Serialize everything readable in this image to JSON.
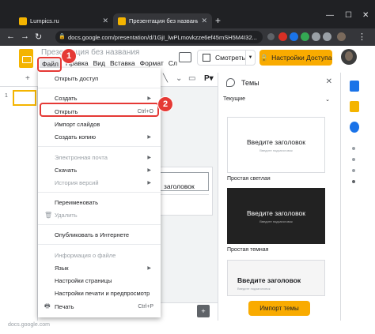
{
  "browser": {
    "tabs": [
      {
        "title": "Lumpics.ru",
        "favicon_color": "#f4b400"
      },
      {
        "title": "Презентация без названия - G",
        "favicon_color": "#f4b400"
      }
    ],
    "address": "docs.google.com/presentation/d/1GjI_lwPLmovkzze6ef45mSH5M4I32..."
  },
  "docs": {
    "title": "Презентация без названия",
    "menubar": [
      "Файл",
      "Правка",
      "Вид",
      "Вставка",
      "Формат",
      "Сл"
    ],
    "present_label": "Смотреть",
    "share_label": "Настройки Доступа",
    "slide_number": "1",
    "slide_title": "заголовок",
    "accent": "#f9ab00"
  },
  "file_menu": {
    "items": [
      {
        "label": "Открыть доступ"
      },
      {
        "label": "Создать",
        "submenu": true
      },
      {
        "label": "Открыть",
        "shortcut": "Ctrl+O"
      },
      {
        "label": "Импорт слайдов"
      },
      {
        "label": "Создать копию",
        "submenu": true
      },
      {
        "label": "Электронная почта",
        "submenu": true,
        "disabled": true
      },
      {
        "label": "Скачать",
        "submenu": true
      },
      {
        "label": "История версий",
        "submenu": true,
        "disabled": true
      },
      {
        "label": "Переименовать"
      },
      {
        "label": "Удалить",
        "disabled": true
      },
      {
        "label": "Опубликовать в Интернете"
      },
      {
        "label": "Информация о файле",
        "disabled": true
      },
      {
        "label": "Язык",
        "submenu": true
      },
      {
        "label": "Настройки страницы"
      },
      {
        "label": "Настройки печати и предпросмотр"
      },
      {
        "label": "Печать",
        "shortcut": "Ctrl+P"
      }
    ]
  },
  "themes": {
    "header": "Темы",
    "selector": "Текущие",
    "cards": [
      {
        "title": "Введите заголовок",
        "subtitle": "Введите подзаголовок",
        "caption": "Простая светлая"
      },
      {
        "title": "Введите заголовок",
        "subtitle": "Введите подзаголовок",
        "caption": "Простая темная"
      },
      {
        "title": "Введите заголовок",
        "subtitle": "Введите подзаголовок",
        "caption": ""
      }
    ],
    "import_label": "Импорт темы"
  },
  "callouts": [
    {
      "number": "1",
      "color": "#e53935"
    },
    {
      "number": "2",
      "color": "#e53935"
    }
  ],
  "status_url": "docs.google.com"
}
